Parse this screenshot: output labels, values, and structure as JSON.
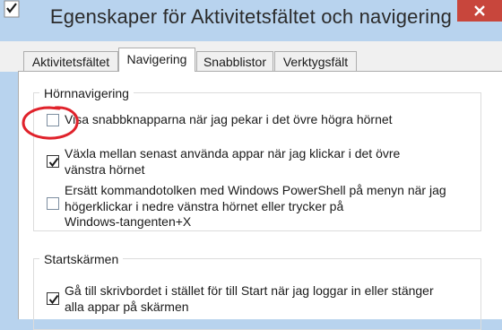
{
  "window": {
    "title": "Egenskaper för Aktivitetsfältet och navigering",
    "colors": {
      "titlebar": "#b8d3ee",
      "close": "#c8463c",
      "panel": "#ffffff",
      "annotation": "#e0222b"
    }
  },
  "tabs": [
    {
      "label": "Aktivitetsfältet",
      "active": false
    },
    {
      "label": "Navigering",
      "active": true
    },
    {
      "label": "Snabblistor",
      "active": false
    },
    {
      "label": "Verktygsfält",
      "active": false
    }
  ],
  "corner_nav": {
    "title": "Hörnnavigering",
    "options": [
      {
        "label": "Visa snabbknapparna när jag pekar i det övre högra hörnet",
        "checked": false
      },
      {
        "lines": [
          "Växla mellan senast använda appar när jag klickar i det övre",
          "vänstra hörnet"
        ],
        "checked": true
      },
      {
        "lines": [
          "Ersätt kommandotolken med Windows PowerShell på menyn när jag",
          "högerklickar i nedre vänstra hörnet eller trycker på",
          "Windows-tangenten+X"
        ],
        "checked": false
      }
    ]
  },
  "start_screen": {
    "title": "Startskärmen",
    "options": [
      {
        "lines": [
          "Gå till skrivbordet i stället för till Start när jag loggar in eller stänger",
          "alla appar på skärmen"
        ],
        "checked": true
      }
    ]
  },
  "icons": {
    "app": "taskbar-properties-icon",
    "close": "close-icon",
    "check": "checkmark-icon",
    "annotation": "red-circle-annotation"
  }
}
